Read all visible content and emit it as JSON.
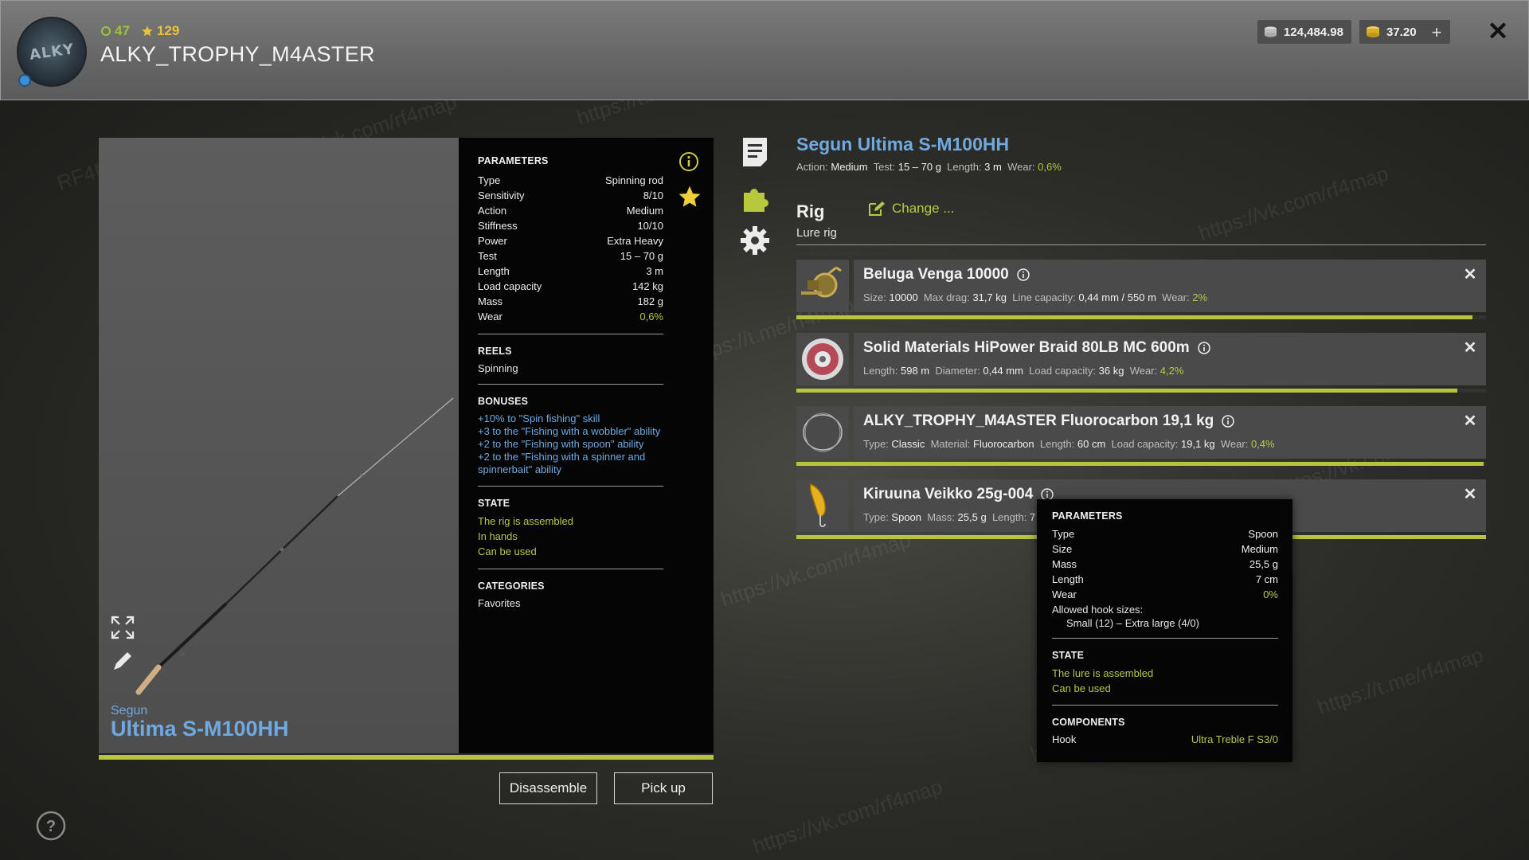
{
  "header": {
    "level": "47",
    "rating": "129",
    "player_name": "ALKY_TROPHY_M4ASTER",
    "avatar_text": "ALKY",
    "silver": "124,484.98",
    "gold": "37.20",
    "plus_label": "+",
    "close_label": "✕"
  },
  "rod_preview": {
    "brand": "Segun",
    "model": "Ultima S-M100HH"
  },
  "details": {
    "parameters_title": "PARAMETERS",
    "parameters": [
      {
        "label": "Type",
        "value": "Spinning rod"
      },
      {
        "label": "Sensitivity",
        "value": "8/10"
      },
      {
        "label": "Action",
        "value": "Medium"
      },
      {
        "label": "Stiffness",
        "value": "10/10"
      },
      {
        "label": "Power",
        "value": "Extra Heavy"
      },
      {
        "label": "Test",
        "value": "15 – 70 g"
      },
      {
        "label": "Length",
        "value": "3 m"
      },
      {
        "label": "Load capacity",
        "value": "142 kg"
      },
      {
        "label": "Mass",
        "value": "182 g"
      },
      {
        "label": "Wear",
        "value": "0,6%"
      }
    ],
    "reels_title": "REELS",
    "reels_value": "Spinning",
    "bonuses_title": "BONUSES",
    "bonuses": [
      "+10% to \"Spin fishing\" skill",
      "+3 to the \"Fishing with a wobbler\" ability",
      "+2 to the \"Fishing with spoon\" ability",
      "+2 to the \"Fishing with a spinner and spinnerbait\" ability"
    ],
    "state_title": "STATE",
    "state": [
      "The rig is assembled",
      "In hands",
      "Can be used"
    ],
    "categories_title": "CATEGORIES",
    "categories_value": "Favorites"
  },
  "buttons": {
    "disassemble": "Disassemble",
    "pickup": "Pick up"
  },
  "rig": {
    "rod_name": "Segun Ultima S-M100HH",
    "rod_meta": {
      "action_label": "Action:",
      "action": "Medium",
      "test_label": "Test:",
      "test": "15 – 70 g",
      "length_label": "Length:",
      "length": "3 m",
      "wear_label": "Wear:",
      "wear": "0,6%"
    },
    "title": "Rig",
    "type": "Lure rig",
    "change_label": "Change ..."
  },
  "slots": [
    {
      "name": "Beluga Venga 10000",
      "meta": [
        {
          "label": "Size:",
          "value": "10000"
        },
        {
          "label": "Max drag:",
          "value": "31,7 kg"
        },
        {
          "label": "Line capacity:",
          "value": "0,44 mm / 550 m"
        },
        {
          "label": "Wear:",
          "value": "2%",
          "accent": true
        }
      ],
      "condition": 0.98
    },
    {
      "name": "Solid Materials HiPower Braid 80LB MC 600m",
      "meta": [
        {
          "label": "Length:",
          "value": "598 m"
        },
        {
          "label": "Diameter:",
          "value": "0,44 mm"
        },
        {
          "label": "Load capacity:",
          "value": "36 kg"
        },
        {
          "label": "Wear:",
          "value": "4,2%",
          "accent": true
        }
      ],
      "condition": 0.958
    },
    {
      "name": "ALKY_TROPHY_M4ASTER Fluorocarbon 19,1 kg",
      "meta": [
        {
          "label": "Type:",
          "value": "Classic"
        },
        {
          "label": "Material:",
          "value": "Fluorocarbon"
        },
        {
          "label": "Length:",
          "value": "60 cm"
        },
        {
          "label": "Load capacity:",
          "value": "19,1 kg"
        },
        {
          "label": "Wear:",
          "value": "0,4%",
          "accent": true
        }
      ],
      "condition": 0.996
    },
    {
      "name": "Kiruuna Veikko 25g-004",
      "meta": [
        {
          "label": "Type:",
          "value": "Spoon"
        },
        {
          "label": "Mass:",
          "value": "25,5 g"
        },
        {
          "label": "Length:",
          "value": "7 c"
        }
      ],
      "condition": 1.0
    }
  ],
  "tooltip": {
    "parameters_title": "PARAMETERS",
    "parameters": [
      {
        "label": "Type",
        "value": "Spoon"
      },
      {
        "label": "Size",
        "value": "Medium"
      },
      {
        "label": "Mass",
        "value": "25,5 g"
      },
      {
        "label": "Length",
        "value": "7 cm"
      },
      {
        "label": "Wear",
        "value": "0%"
      }
    ],
    "hook_sizes_label": "Allowed hook sizes:",
    "hook_sizes_value": "Small (12) – Extra large (4/0)",
    "state_title": "STATE",
    "state": [
      "The lure is assembled",
      "Can be used"
    ],
    "components_title": "COMPONENTS",
    "component_label": "Hook",
    "component_value": "Ultra Treble F S3/0"
  },
  "watermarks": [
    "RF4Map",
    "https://vk.com/rf4map",
    "https://t.me/rf4map"
  ],
  "colors": {
    "accent_green": "#b8c43e",
    "link_blue": "#6fa9e0"
  },
  "icons": [
    "avatar",
    "level-icon",
    "rating-star-icon",
    "silver-coin-icon",
    "gold-coin-icon",
    "plus-icon",
    "close-icon",
    "info-icon",
    "favorite-star-icon",
    "fullscreen-icon",
    "edit-icon",
    "document-icon",
    "puzzle-icon",
    "gear-icon",
    "help-icon",
    "change-edit-icon"
  ]
}
